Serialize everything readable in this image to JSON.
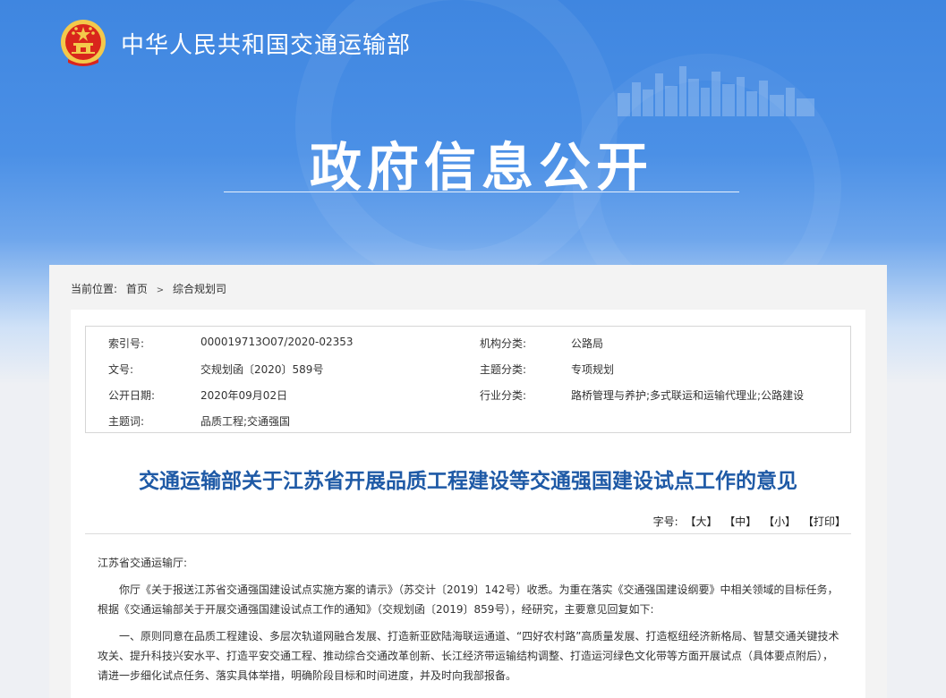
{
  "header": {
    "site_name": "中华人民共和国交通运输部",
    "banner_title": "政府信息公开"
  },
  "breadcrumb": {
    "label": "当前位置:",
    "items": [
      "首页",
      "综合规划司"
    ],
    "separator": ">"
  },
  "meta": {
    "rows": [
      {
        "k1": "索引号:",
        "v1": "000019713O07/2020-02353",
        "k2": "机构分类:",
        "v2": "公路局"
      },
      {
        "k1": "文号:",
        "v1": "交规划函〔2020〕589号",
        "k2": "主题分类:",
        "v2": "专项规划"
      },
      {
        "k1": "公开日期:",
        "v1": "2020年09月02日",
        "k2": "行业分类:",
        "v2": "路桥管理与养护;多式联运和运输代理业;公路建设"
      },
      {
        "k1": "主题词:",
        "v1": "品质工程;交通强国",
        "k2": "",
        "v2": ""
      }
    ]
  },
  "document": {
    "title": "交通运输部关于江苏省开展品质工程建设等交通强国建设试点工作的意见",
    "font_size_label": "字号:",
    "font_buttons": [
      "【大】",
      "【中】",
      "【小】",
      "【打印】"
    ],
    "salutation": "江苏省交通运输厅:",
    "para1": "你厅《关于报送江苏省交通强国建设试点实施方案的请示》（苏交计〔2019〕142号）收悉。为重在落实《交通强国建设纲要》中相关领域的目标任务，根据《交通运输部关于开展交通强国建设试点工作的通知》（交规划函〔2019〕859号），经研究，主要意见回复如下:",
    "para2": "一、原则同意在品质工程建设、多层次轨道网融合发展、打造新亚欧陆海联运通道、“四好农村路”高质量发展、打造枢纽经济新格局、智慧交通关键技术攻关、提升科技兴安水平、打造平安交通工程、推动综合交通改革创新、长江经济带运输结构调整、打造运河绿色文化带等方面开展试点（具体要点附后），请进一步细化试点任务、落实具体举措，明确阶段目标和时间进度，并及时向我部报备。"
  },
  "colors": {
    "banner_blue": "#4b90e6",
    "title_blue": "#1f5aa6",
    "emblem_red": "#d9251c",
    "emblem_gold": "#f3c94b"
  }
}
